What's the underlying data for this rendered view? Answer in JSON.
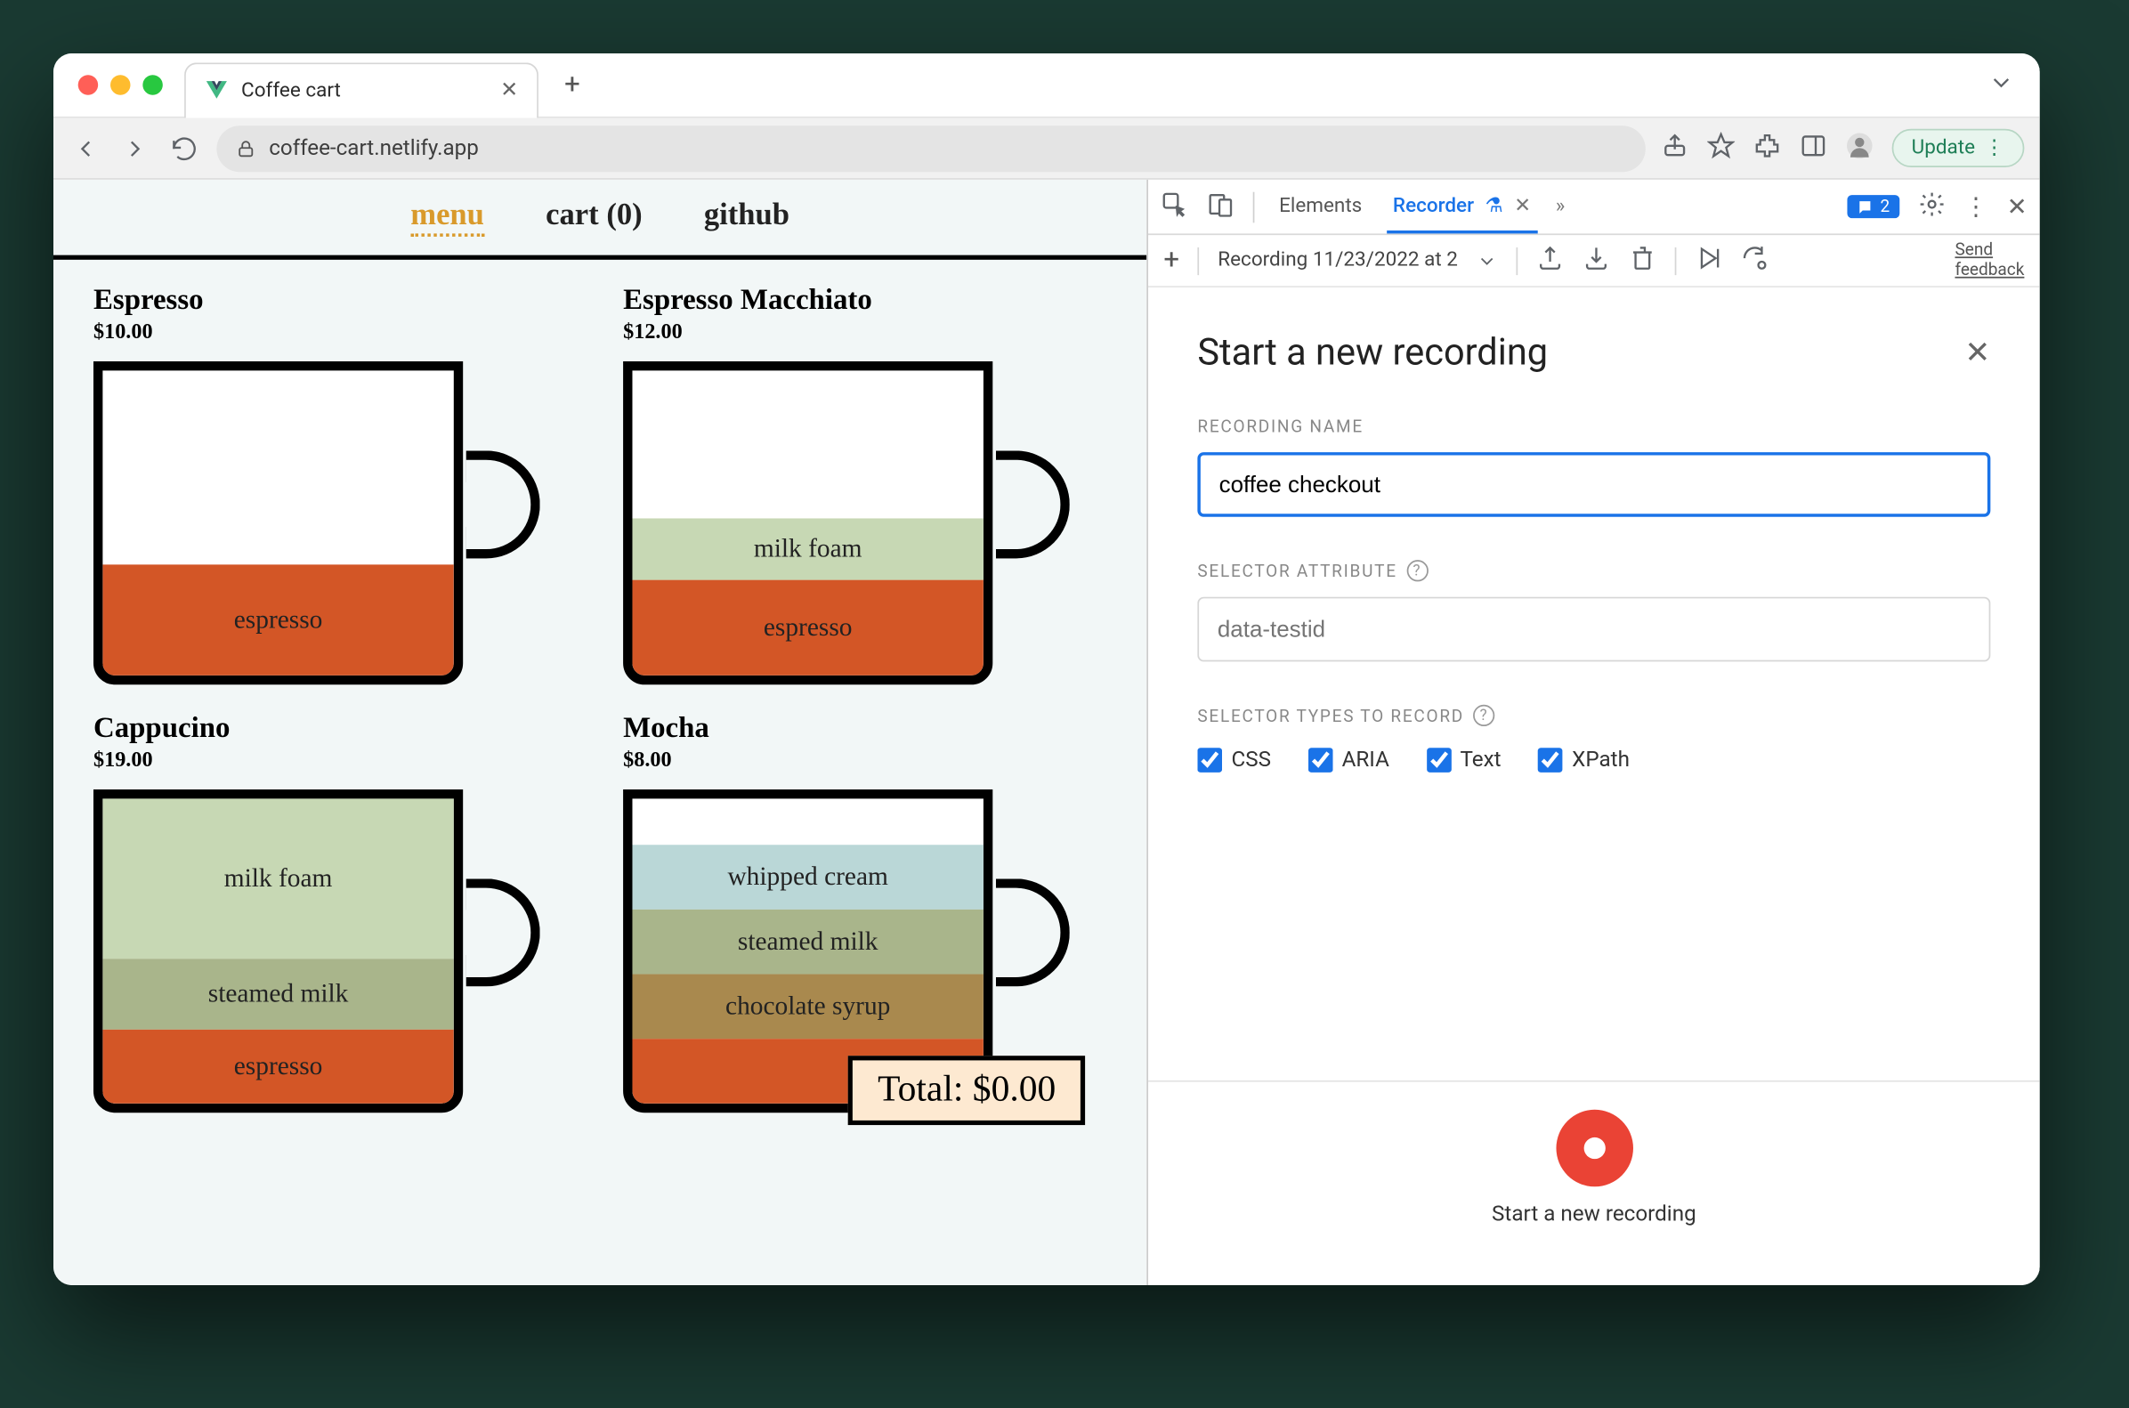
{
  "browser": {
    "tab_title": "Coffee cart",
    "url": "coffee-cart.netlify.app",
    "update_label": "Update"
  },
  "page": {
    "nav": {
      "menu": "menu",
      "cart": "cart (0)",
      "github": "github"
    },
    "products": [
      {
        "name": "Espresso",
        "price": "$10.00",
        "layers": [
          {
            "label": "espresso",
            "cls": "c-espresso",
            "h": 72
          }
        ]
      },
      {
        "name": "Espresso Macchiato",
        "price": "$12.00",
        "layers": [
          {
            "label": "espresso",
            "cls": "c-espresso",
            "h": 62
          },
          {
            "label": "milk foam",
            "cls": "c-milkfoam",
            "h": 40
          }
        ]
      },
      {
        "name": "Cappucino",
        "price": "$19.00",
        "layers": [
          {
            "label": "espresso",
            "cls": "c-espresso",
            "h": 48
          },
          {
            "label": "steamed milk",
            "cls": "c-steamed",
            "h": 46
          },
          {
            "label": "milk foam",
            "cls": "c-milkfoam",
            "h": 104
          }
        ]
      },
      {
        "name": "Mocha",
        "price": "$8.00",
        "layers": [
          {
            "label": "",
            "cls": "c-espresso",
            "h": 42
          },
          {
            "label": "chocolate syrup",
            "cls": "c-chocolate",
            "h": 42
          },
          {
            "label": "steamed milk",
            "cls": "c-steamed",
            "h": 42
          },
          {
            "label": "whipped cream",
            "cls": "c-whipped",
            "h": 42
          }
        ]
      }
    ],
    "total": "Total: $0.00"
  },
  "devtools": {
    "tabs": {
      "elements": "Elements",
      "recorder": "Recorder"
    },
    "issues_count": "2",
    "toolbar": {
      "recording_title": "Recording 11/23/2022 at 2",
      "feedback1": "Send",
      "feedback2": "feedback"
    },
    "panel": {
      "title": "Start a new recording",
      "recording_name_label": "RECORDING NAME",
      "recording_name_value": "coffee checkout",
      "selector_attr_label": "SELECTOR ATTRIBUTE",
      "selector_attr_placeholder": "data-testid",
      "selector_types_label": "SELECTOR TYPES TO RECORD",
      "types": {
        "css": "CSS",
        "aria": "ARIA",
        "text": "Text",
        "xpath": "XPath"
      },
      "start_label": "Start a new recording"
    }
  }
}
